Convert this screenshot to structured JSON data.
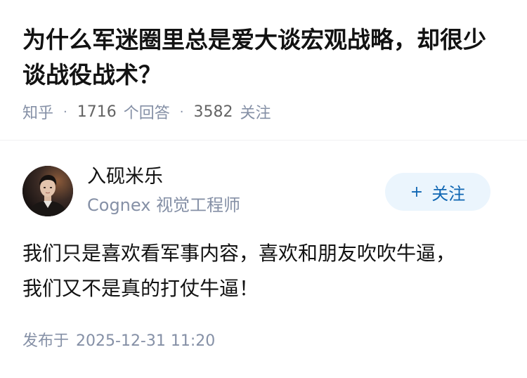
{
  "question": {
    "title": "为什么军迷圈里总是爱大谈宏观战略，却很少谈战役战术？",
    "source": "知乎",
    "separator": "·",
    "answer_count": "1716",
    "answer_label": "个回答",
    "follower_count": "3582",
    "follower_label": "关注"
  },
  "answer": {
    "author_name": "入砚米乐",
    "author_headline": "Cognex 视觉工程师",
    "follow_label": "关注",
    "follow_icon": "+",
    "paragraphs": [
      "我们只是喜欢看军事内容，喜欢和朋友吹吹牛逼，",
      "我们又不是真的打仗牛逼！"
    ],
    "publish_label": "发布于",
    "publish_time": "2025-12-31 11:20"
  },
  "colors": {
    "title": "#121212",
    "meta": "#8590a6",
    "follow_bg": "#ebf5fd",
    "follow_text": "#0f66b3"
  }
}
